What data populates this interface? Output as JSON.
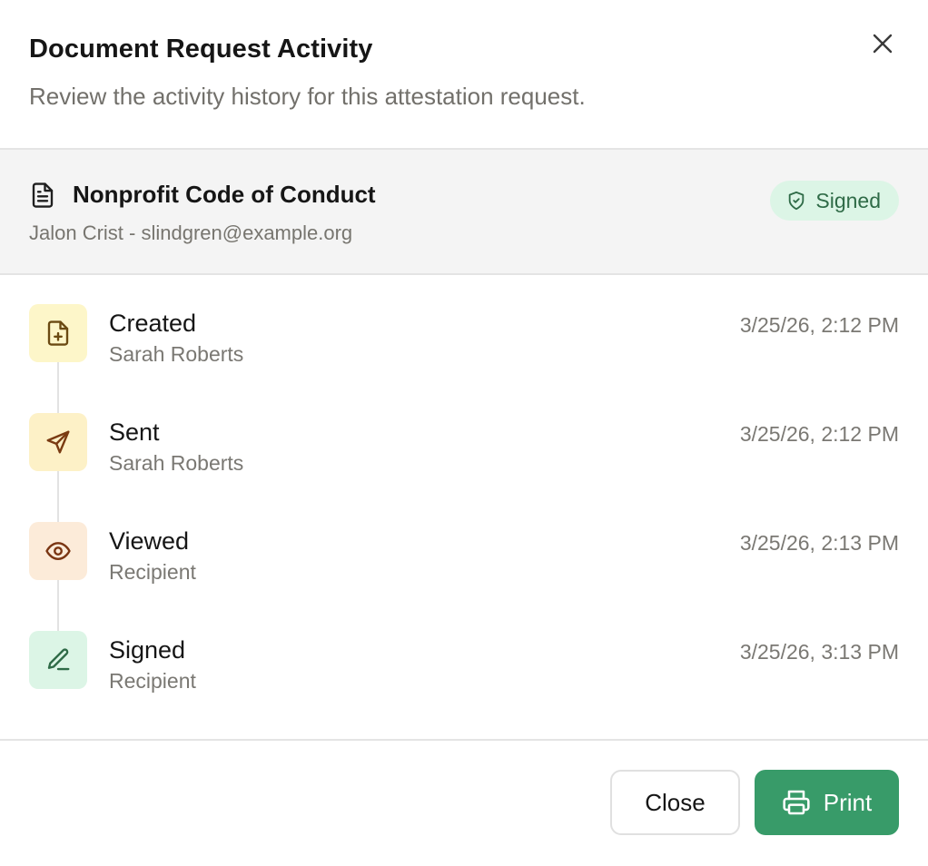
{
  "dialog": {
    "title": "Document Request Activity",
    "subtitle": "Review the activity history for this attestation request.",
    "close_icon": "x-icon"
  },
  "document": {
    "icon": "file-text-icon",
    "name": "Nonprofit Code of Conduct",
    "recipient": "Jalon Crist - slindgren@example.org",
    "status": {
      "label": "Signed",
      "icon": "shield-check-icon",
      "bg_color": "#dcf5e6",
      "text_color": "#2f6b47"
    }
  },
  "events": [
    {
      "label": "Created",
      "actor": "Sarah Roberts",
      "time": "3/25/26, 2:12 PM",
      "icon": "file-plus-icon",
      "bg_color": "#fdf6c9",
      "icon_color": "#6b4a12"
    },
    {
      "label": "Sent",
      "actor": "Sarah Roberts",
      "time": "3/25/26, 2:12 PM",
      "icon": "send-icon",
      "bg_color": "#fdf1c7",
      "icon_color": "#7a3b12"
    },
    {
      "label": "Viewed",
      "actor": "Recipient",
      "time": "3/25/26, 2:13 PM",
      "icon": "eye-icon",
      "bg_color": "#fcebd9",
      "icon_color": "#7a3512"
    },
    {
      "label": "Signed",
      "actor": "Recipient",
      "time": "3/25/26, 3:13 PM",
      "icon": "pen-line-icon",
      "bg_color": "#dcf5e6",
      "icon_color": "#2f6b47"
    }
  ],
  "footer": {
    "close_label": "Close",
    "print_label": "Print",
    "print_icon": "printer-icon",
    "print_color": "#389b69"
  }
}
